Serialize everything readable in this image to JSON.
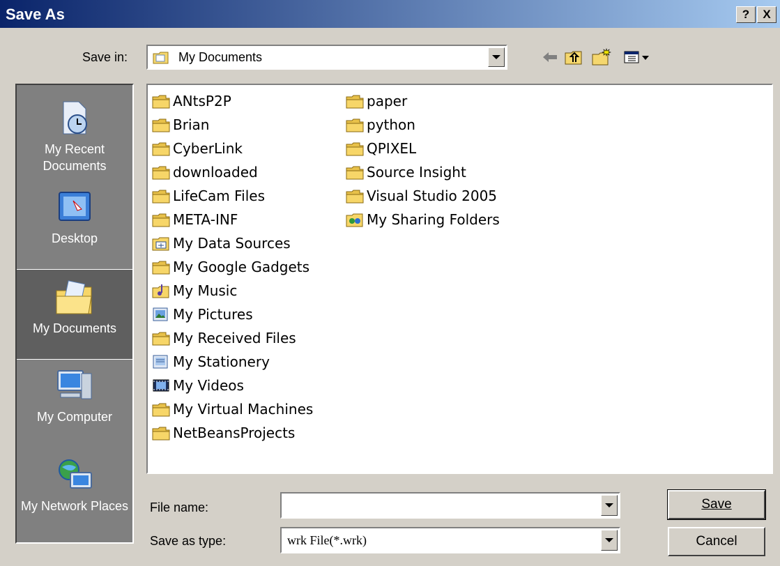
{
  "window": {
    "title": "Save As",
    "help_button": "?",
    "close_button": "X"
  },
  "toolbar": {
    "save_in_label": "Save in:",
    "save_in_value": "My Documents",
    "icons": [
      "back-arrow-icon",
      "up-one-level-icon",
      "create-new-folder-icon",
      "view-menu-icon"
    ]
  },
  "places": [
    {
      "label": "My Recent Documents",
      "icon": "recent-documents-icon"
    },
    {
      "label": "Desktop",
      "icon": "desktop-icon"
    },
    {
      "label": "My Documents",
      "icon": "my-documents-icon",
      "selected": true
    },
    {
      "label": "My Computer",
      "icon": "my-computer-icon"
    },
    {
      "label": "My Network Places",
      "icon": "network-places-icon"
    }
  ],
  "files": {
    "column1": [
      {
        "name": "ANtsP2P",
        "icon": "folder-icon"
      },
      {
        "name": "Brian",
        "icon": "folder-icon"
      },
      {
        "name": "CyberLink",
        "icon": "folder-icon"
      },
      {
        "name": "downloaded",
        "icon": "folder-icon"
      },
      {
        "name": "LifeCam Files",
        "icon": "folder-icon"
      },
      {
        "name": "META-INF",
        "icon": "folder-icon"
      },
      {
        "name": "My Data Sources",
        "icon": "data-sources-folder-icon"
      },
      {
        "name": "My Google Gadgets",
        "icon": "folder-icon"
      },
      {
        "name": "My Music",
        "icon": "music-folder-icon"
      },
      {
        "name": "My Pictures",
        "icon": "pictures-folder-icon"
      },
      {
        "name": "My Received Files",
        "icon": "folder-icon"
      },
      {
        "name": "My Stationery",
        "icon": "stationery-folder-icon"
      },
      {
        "name": "My Videos",
        "icon": "videos-folder-icon"
      },
      {
        "name": "My Virtual Machines",
        "icon": "folder-icon"
      },
      {
        "name": "NetBeansProjects",
        "icon": "folder-icon"
      }
    ],
    "column2": [
      {
        "name": "paper",
        "icon": "folder-icon"
      },
      {
        "name": "python",
        "icon": "folder-icon"
      },
      {
        "name": "QPIXEL",
        "icon": "folder-icon"
      },
      {
        "name": "Source Insight",
        "icon": "folder-icon"
      },
      {
        "name": "Visual Studio 2005",
        "icon": "folder-icon"
      },
      {
        "name": "My Sharing Folders",
        "icon": "sharing-folders-icon"
      }
    ]
  },
  "bottom": {
    "file_name_label": "File name:",
    "file_name_value": "",
    "save_as_type_label": "Save as type:",
    "save_as_type_value": "wrk File(*.wrk)",
    "save_button": "Save",
    "cancel_button": "Cancel"
  },
  "colors": {
    "dialog_bg": "#d4d0c8",
    "title_start": "#0a246a",
    "title_end": "#a6caf0",
    "places_bg": "#808080",
    "folder_yellow": "#f7d668"
  }
}
